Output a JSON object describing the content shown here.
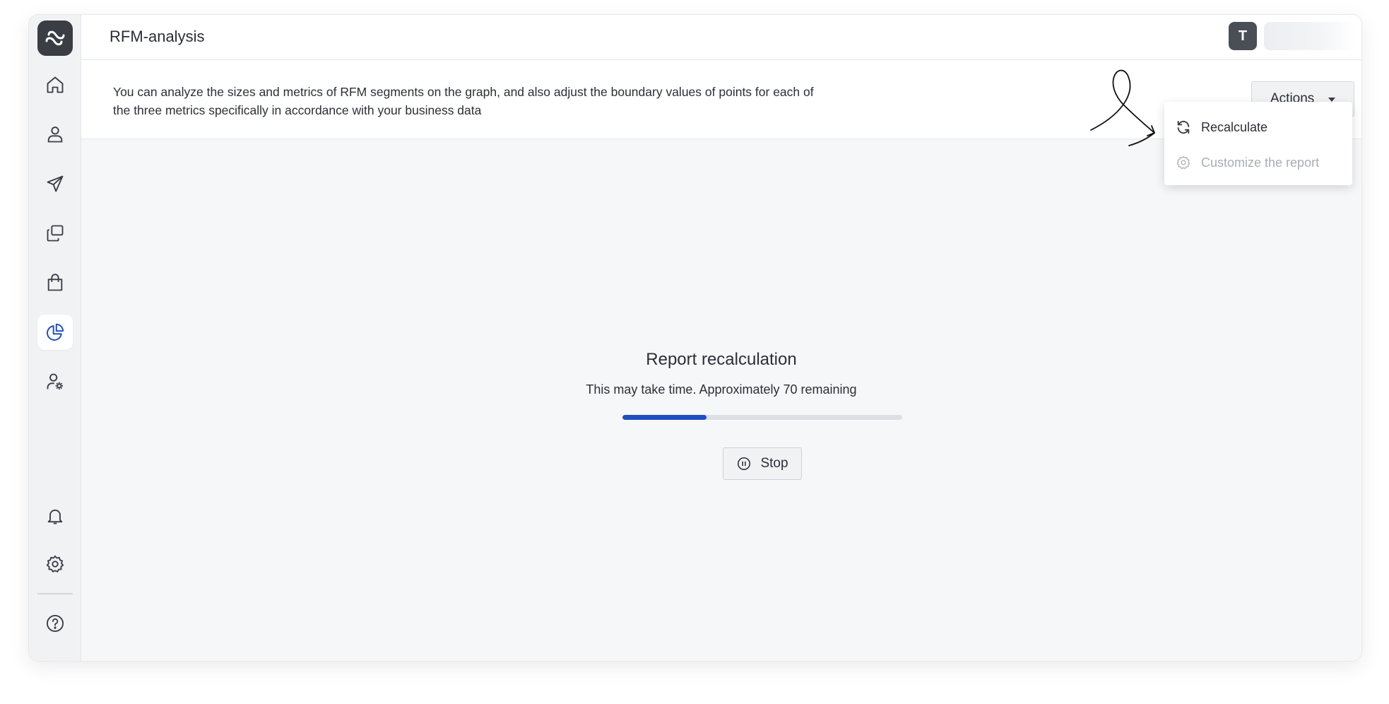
{
  "header": {
    "title": "RFM-analysis",
    "avatar_initial": "T"
  },
  "description": "You can analyze the sizes and metrics of RFM segments on the graph, and also adjust the boundary values of points for each of the three metrics specifically in accordance with your business data",
  "actions": {
    "label": "Actions",
    "menu": [
      {
        "label": "Recalculate",
        "icon": "refresh-icon",
        "enabled": true
      },
      {
        "label": "Customize the report",
        "icon": "gear-icon",
        "enabled": false
      }
    ]
  },
  "recalculation": {
    "title": "Report recalculation",
    "subtitle": "This may take time. Approximately 70 remaining",
    "progress_fraction": 0.3,
    "stop_label": "Stop"
  },
  "sidebar": {
    "items": [
      {
        "name": "home",
        "icon": "home-icon",
        "active": false
      },
      {
        "name": "customers",
        "icon": "user-icon",
        "active": false
      },
      {
        "name": "campaigns",
        "icon": "send-icon",
        "active": false
      },
      {
        "name": "content",
        "icon": "copy-icon",
        "active": false
      },
      {
        "name": "shop",
        "icon": "shopping-bag-icon",
        "active": false
      },
      {
        "name": "analytics",
        "icon": "pie-chart-icon",
        "active": true
      },
      {
        "name": "user-settings",
        "icon": "user-gear-icon",
        "active": false
      },
      {
        "name": "notifications",
        "icon": "bell-icon",
        "active": false
      },
      {
        "name": "settings",
        "icon": "gear-icon",
        "active": false
      },
      {
        "name": "help",
        "icon": "help-icon",
        "active": false
      }
    ]
  },
  "colors": {
    "accent": "#1e4fc2",
    "sidebar_bg": "#f1f2f4",
    "logo_bg": "#3a3d44"
  }
}
